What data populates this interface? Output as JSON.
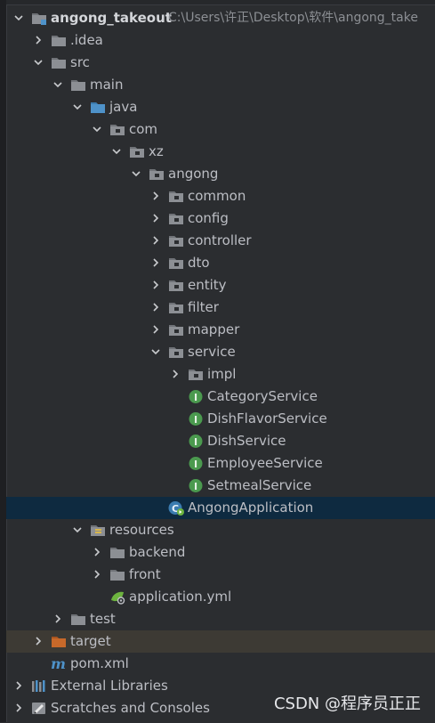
{
  "project": {
    "name": "angong_takeout",
    "path": "C:\\Users\\许正\\Desktop\\软件\\angong_take"
  },
  "tree": [
    {
      "label": "angong_takeout",
      "depth": 0,
      "arrow": "down",
      "icon": "module-folder-icon",
      "bold": true,
      "path": "C:\\Users\\许正\\Desktop\\软件\\angong_take"
    },
    {
      "label": ".idea",
      "depth": 1,
      "arrow": "right",
      "icon": "folder-icon"
    },
    {
      "label": "src",
      "depth": 1,
      "arrow": "down",
      "icon": "folder-icon"
    },
    {
      "label": "main",
      "depth": 2,
      "arrow": "down",
      "icon": "folder-icon"
    },
    {
      "label": "java",
      "depth": 3,
      "arrow": "down",
      "icon": "source-folder-icon"
    },
    {
      "label": "com",
      "depth": 4,
      "arrow": "down",
      "icon": "package-icon"
    },
    {
      "label": "xz",
      "depth": 5,
      "arrow": "down",
      "icon": "package-icon"
    },
    {
      "label": "angong",
      "depth": 6,
      "arrow": "down",
      "icon": "package-icon"
    },
    {
      "label": "common",
      "depth": 7,
      "arrow": "right",
      "icon": "package-icon"
    },
    {
      "label": "config",
      "depth": 7,
      "arrow": "right",
      "icon": "package-icon"
    },
    {
      "label": "controller",
      "depth": 7,
      "arrow": "right",
      "icon": "package-icon"
    },
    {
      "label": "dto",
      "depth": 7,
      "arrow": "right",
      "icon": "package-icon"
    },
    {
      "label": "entity",
      "depth": 7,
      "arrow": "right",
      "icon": "package-icon"
    },
    {
      "label": "filter",
      "depth": 7,
      "arrow": "right",
      "icon": "package-icon"
    },
    {
      "label": "mapper",
      "depth": 7,
      "arrow": "right",
      "icon": "package-icon"
    },
    {
      "label": "service",
      "depth": 7,
      "arrow": "down",
      "icon": "package-icon"
    },
    {
      "label": "impl",
      "depth": 8,
      "arrow": "right",
      "icon": "package-icon"
    },
    {
      "label": "CategoryService",
      "depth": 8,
      "arrow": "none",
      "icon": "interface-icon"
    },
    {
      "label": "DishFlavorService",
      "depth": 8,
      "arrow": "none",
      "icon": "interface-icon"
    },
    {
      "label": "DishService",
      "depth": 8,
      "arrow": "none",
      "icon": "interface-icon"
    },
    {
      "label": "EmployeeService",
      "depth": 8,
      "arrow": "none",
      "icon": "interface-icon"
    },
    {
      "label": "SetmealService",
      "depth": 8,
      "arrow": "none",
      "icon": "interface-icon"
    },
    {
      "label": "AngongApplication",
      "depth": 7,
      "arrow": "none",
      "icon": "spring-boot-app-icon",
      "selected": true
    },
    {
      "label": "resources",
      "depth": 3,
      "arrow": "down",
      "icon": "resources-folder-icon"
    },
    {
      "label": "backend",
      "depth": 4,
      "arrow": "right",
      "icon": "folder-icon"
    },
    {
      "label": "front",
      "depth": 4,
      "arrow": "right",
      "icon": "folder-icon"
    },
    {
      "label": "application.yml",
      "depth": 4,
      "arrow": "none",
      "icon": "yaml-config-icon"
    },
    {
      "label": "test",
      "depth": 2,
      "arrow": "right",
      "icon": "folder-icon"
    },
    {
      "label": "target",
      "depth": 1,
      "arrow": "right",
      "icon": "excluded-folder-icon",
      "highlight": true
    },
    {
      "label": "pom.xml",
      "depth": 1,
      "arrow": "none",
      "icon": "maven-icon"
    },
    {
      "label": "External Libraries",
      "depth": 0,
      "arrow": "right",
      "icon": "libraries-icon"
    },
    {
      "label": "Scratches and Consoles",
      "depth": 0,
      "arrow": "right",
      "icon": "scratches-icon"
    }
  ],
  "watermark": "CSDN @程序员正正",
  "colors": {
    "background": "#2b2d30",
    "selected_row": "#0e2a40",
    "highlight_row": "#3d3a34",
    "folder": "#8c8f94",
    "source_folder": "#4e92c9",
    "interface_badge": "#4b9a4f",
    "excluded_folder": "#c8692a"
  }
}
